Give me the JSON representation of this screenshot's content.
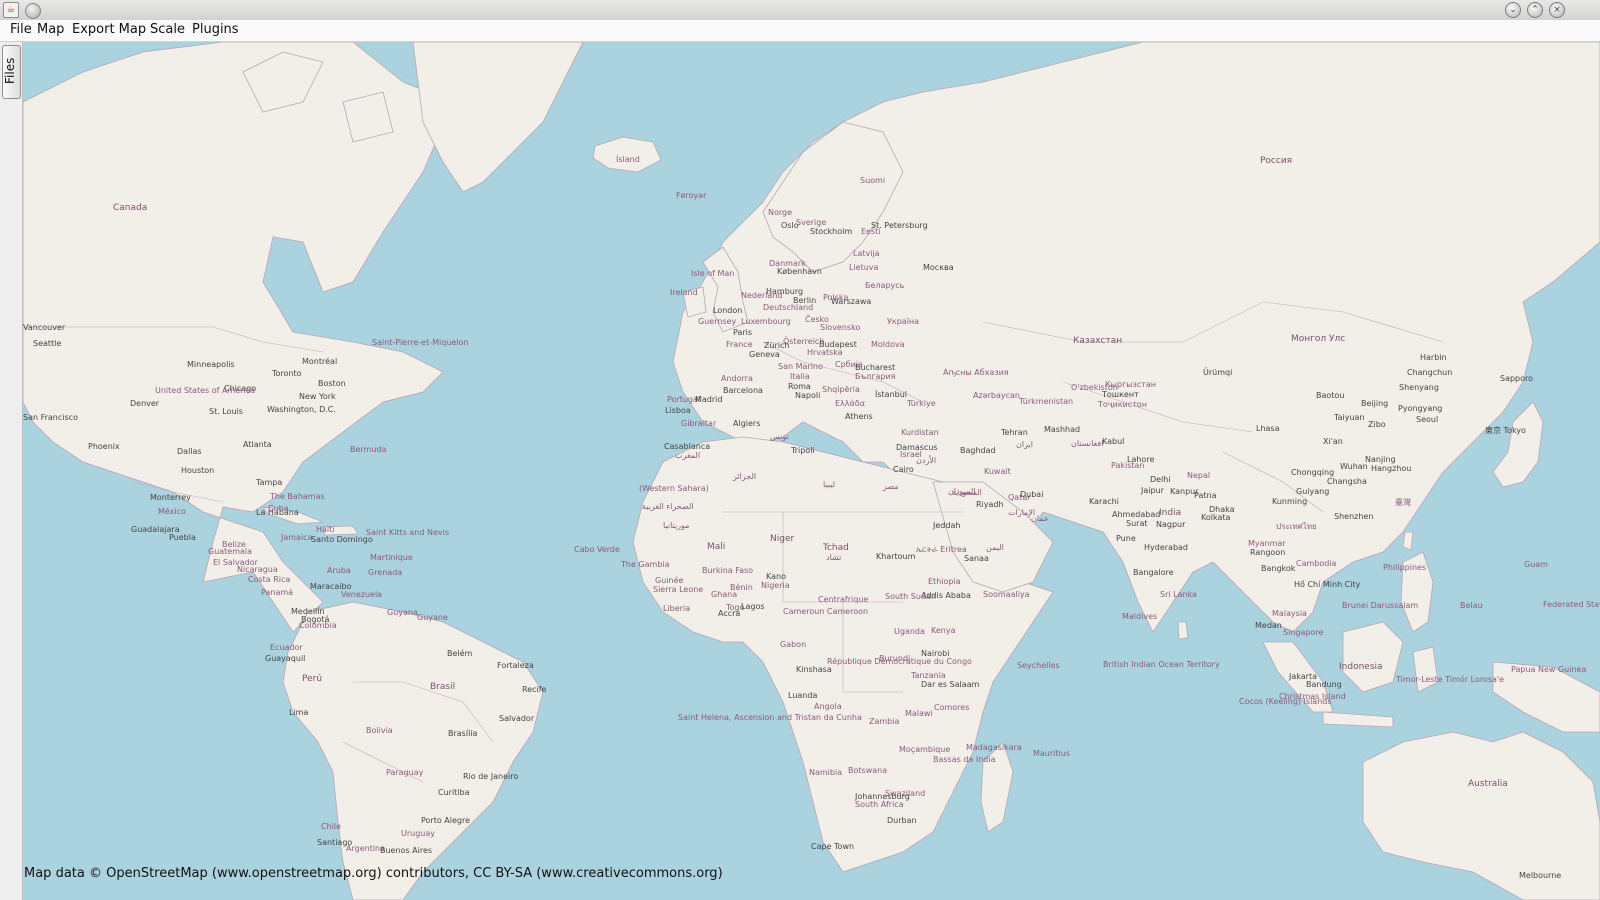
{
  "window": {
    "app_icon_glyph": "☕"
  },
  "menubar": {
    "items": [
      "File",
      "Map",
      "Export Map",
      "Scale",
      "Plugins"
    ]
  },
  "sidebar": {
    "tab_label": "Files"
  },
  "map": {
    "colors": {
      "water": "#aad3df",
      "land": "#f2efe9",
      "borders": "#b9a5b5"
    },
    "labels": {
      "island": "Ísland",
      "foroyar": "Føroyar",
      "canada": "Canada",
      "rossiya": "Россия",
      "suomi": "Suomi",
      "norge": "Norge",
      "sverige": "Sverige",
      "oslo": "Oslo",
      "stockholm": "Stockholm",
      "eesti": "Eesti",
      "stpetersburg": "St. Petersburg",
      "latvija": "Latvija",
      "lietuva": "Lietuva",
      "moscow": "Москва",
      "danmark": "Danmark",
      "kobenhavn": "København",
      "isleofman": "Isle of Man",
      "ireland": "Ireland",
      "hamburg": "Hamburg",
      "nederland": "Nederland",
      "berlin": "Berlin",
      "deutschland": "Deutschland",
      "polska": "Polska",
      "warszawa": "Warszawa",
      "belarus": "Беларусь",
      "london": "London",
      "guernsey": "Guernsey",
      "luxembourg": "Luxembourg",
      "cesko": "Česko",
      "slovensko": "Slovensko",
      "ukraina": "Україна",
      "paris": "Paris",
      "france": "France",
      "osterreich": "Österreich",
      "budapest": "Budapest",
      "moldova": "Moldova",
      "geneva": "Geneva",
      "zurich": "Zürich",
      "hrvatska": "Hrvatska",
      "bucharest": "Bucharest",
      "srbija": "Србија",
      "balgaria": "България",
      "andorra": "Andorra",
      "sanmarino": "San Marino",
      "italia": "Italia",
      "roma": "Roma",
      "napoli": "Napoli",
      "shqiperia": "Shqipëria",
      "istanbul": "İstanbul",
      "barcelona": "Barcelona",
      "portugal": "Portugal",
      "madrid": "Madrid",
      "lisboa": "Lisboa",
      "ellada": "Ελλάδα",
      "athens": "Athens",
      "turkiye": "Türkiye",
      "gibraltar": "Gibraltar",
      "algiers": "Algiers",
      "tunis": "تونس",
      "casablanca": "Casablanca",
      "maghrib": "المغرب",
      "tripoli": "Tripoli",
      "jazair": "الجزائر",
      "libya": "ليبيا",
      "misr": "مصر",
      "cairo": "Cairo",
      "westernsahara": "(Western Sahara)",
      "sahra": "الصحراء الغربية",
      "mauritania": "موريتانيا",
      "mali": "Mali",
      "niger": "Niger",
      "tchad": "Tchad",
      "tchad_ar": "تشاد",
      "sudan": "السودان",
      "khartoum": "Khartoum",
      "eritrea": "ኤርትራ Eritrea",
      "ethiopia": "Ethiopia",
      "addis": "Addis Ababa",
      "somalia": "Soomaaliya",
      "thegambia": "The Gambia",
      "guinee": "Guinée",
      "sierraleone": "Sierra Leone",
      "liberia": "Liberia",
      "burkina": "Burkina Faso",
      "ghana": "Ghana",
      "benin": "Bénin",
      "togo": "Togo",
      "kano": "Kano",
      "nigeria": "Nigeria",
      "accra": "Accra",
      "lagos": "Lagos",
      "cameroun": "Cameroun Cameroon",
      "centrafrique": "Centrafrique",
      "southsudan": "South Sudan",
      "uganda": "Uganda",
      "kenya": "Kenya",
      "nairobi": "Nairobi",
      "gabon": "Gabon",
      "kinshasa": "Kinshasa",
      "rdc": "République Démocratique du Congo",
      "burundi": "Burundi",
      "tanzania": "Tanzania",
      "daressalaam": "Dar es Salaam",
      "luanda": "Luanda",
      "angola": "Angola",
      "zambia": "Zambia",
      "malawi": "Malawi",
      "comores": "Comores",
      "mocambique": "Moçambique",
      "madagasikara": "Madagasikara",
      "namibia": "Namibia",
      "botswana": "Botswana",
      "swaziland": "Swaziland",
      "southafrica": "South Africa",
      "durban": "Durban",
      "capetown": "Cape Town",
      "johannesburg": "Johannesburg",
      "bassas": "Bassas da India",
      "mauritius": "Mauritius",
      "seychelles": "Seychelles",
      "maldives": "Maldives",
      "biot": "British Indian Ocean Territory",
      "kazakhstan": "Казахстан",
      "mongol": "Монгол Улс",
      "harbin": "Harbin",
      "urumqi": "Ürümqi",
      "changchun": "Changchun",
      "shenyang": "Shenyang",
      "sapporo": "Sapporo",
      "baotou": "Baotou",
      "beijing": "Beijing",
      "pyongyang": "Pyongyang",
      "seoul": "Seoul",
      "tokyo": "東京 Tokyo",
      "uzbekiston": "O'zbekiston",
      "kyrgyzstan": "Кыргызстан",
      "tashkent": "Тошкент",
      "tajikistan": "Тоҷикистон",
      "turkmenistan": "Türkmenistan",
      "azerbaijan": "Azərbaycan",
      "abkhazia": "Аҧсны Абхазия",
      "tehran": "Tehran",
      "iran": "ایران",
      "mashhad": "Mashhad",
      "afghanistan": "افغانستان",
      "kabul": "Kabul",
      "pakistan": "Pakistan",
      "lahore": "Lahore",
      "kurdistan": "Kurdistan",
      "baghdad": "Baghdad",
      "damascus": "Damascus",
      "israel": "Israel",
      "jordan": "الأردن",
      "riyadh": "Riyadh",
      "saudi": "السعودية",
      "kuwait": "Kuwait",
      "qatar": "Qatar",
      "dubai": "Dubai",
      "emirates": "الإمارات",
      "oman": "عمان",
      "jeddah": "Jeddah",
      "sanaa": "Sanaa",
      "yemen": "اليمن",
      "karachi": "Karachi",
      "delhi": "Delhi",
      "jaipur": "Jaipur",
      "kanpur": "Kanpur",
      "nepal": "Nepal",
      "patna": "Patna",
      "ahmedabad": "Ahmedabad",
      "surat": "Surat",
      "india": "India",
      "nagpur": "Nagpur",
      "kolkata": "Kolkata",
      "dhaka": "Dhaka",
      "pune": "Pune",
      "hyderabad": "Hyderabad",
      "bangalore": "Bangalore",
      "srilanka": "Sri Lanka",
      "lhasa": "Lhasa",
      "xian": "Xi'an",
      "zibo": "Zibo",
      "taiyuan": "Taiyuan",
      "chongqing": "Chongqing",
      "wuhan": "Wuhan",
      "nanjing": "Nanjing",
      "hangzhou": "Hangzhou",
      "changsha": "Changsha",
      "guiyang": "Guiyang",
      "kunming": "Kunming",
      "taiwan": "臺灣",
      "shenzhen": "Shenzhen",
      "myanmar": "Myanmar",
      "rangoon": "Rangoon",
      "thailand": "ประเทศไทย",
      "bangkok": "Bangkok",
      "cambodia": "Cambodia",
      "hochiminh": "Hồ Chí Minh City",
      "philippines": "Philippines",
      "malaysia": "Malaysia",
      "medan": "Medan",
      "singapore": "Singapore",
      "brunei": "Brunei Darussalam",
      "indonesia": "Indonesia",
      "bandung": "Bandung",
      "jakarta": "Jakarta",
      "timorleste": "Timor-Leste Timór Lorosa'e",
      "papua": "Papua New Guinea",
      "guam": "Guam",
      "palau": "Belau",
      "christmas": "Christmas Island",
      "cocos": "Cocos (Keeling) Islands",
      "australia": "Australia",
      "melbourne": "Melbourne",
      "micronesia": "Federated States of Micronesia",
      "vancouver": "Vancouver",
      "seattle": "Seattle",
      "sanfrancisco": "San Francisco",
      "minneapolis": "Minneapolis",
      "chicago": "Chicago",
      "toronto": "Toronto",
      "montreal": "Montréal",
      "boston": "Boston",
      "newyork": "New York",
      "washington": "Washington, D.C.",
      "usa": "United States of America",
      "denver": "Denver",
      "stlouis": "St. Louis",
      "phoenix": "Phoenix",
      "dallas": "Dallas",
      "atlanta": "Atlanta",
      "houston": "Houston",
      "tampa": "Tampa",
      "bermuda": "Bermuda",
      "saintpierre": "Saint-Pierre-et-Miquelon",
      "bahamas": "The Bahamas",
      "monterrey": "Monterrey",
      "mexico": "México",
      "habana": "La Habana",
      "cuba": "Cuba",
      "guadalajara": "Guadalajara",
      "puebla": "Puebla",
      "belize": "Belize",
      "guatemala": "Guatemala",
      "elsalvador": "El Salvador",
      "nicaragua": "Nicaragua",
      "costarica": "Costa Rica",
      "panama": "Panamá",
      "haiti": "Haïti",
      "jamaica": "Jamaica",
      "santodomingo": "Santo Domingo",
      "saintkitts": "Saint Kitts and Nevis",
      "martinique": "Martinique",
      "aruba": "Aruba",
      "grenada": "Grenada",
      "maracaibo": "Maracaibo",
      "venezuela": "Venezuela",
      "medellin": "Medellín",
      "bogota": "Bogotá",
      "colombia": "Colombia",
      "guyana": "Guyana",
      "guyane": "Guyane",
      "ecuador": "Ecuador",
      "guayaquil": "Guayaquil",
      "peru": "Perú",
      "lima": "Lima",
      "belem": "Belém",
      "fortaleza": "Fortaleza",
      "recife": "Recife",
      "brasil": "Brasil",
      "salvador": "Salvador",
      "bolivia": "Bolivia",
      "brasilia": "Brasília",
      "paraguay": "Paraguay",
      "riodejaneiro": "Rio de Janeiro",
      "curitiba": "Curitiba",
      "portoalegre": "Porto Alegre",
      "uruguay": "Uruguay",
      "chile": "Chile",
      "santiago": "Santiago",
      "argentina": "Argentina",
      "buenosaires": "Buenos Aires",
      "caboverde": "Cabo Verde",
      "sainthelena": "Saint Helena, Ascension and Tristan da Cunha"
    }
  },
  "status": {
    "attribution": "Map data © OpenStreetMap (www.openstreetmap.org) contributors, CC BY-SA (www.creativecommons.org)"
  }
}
